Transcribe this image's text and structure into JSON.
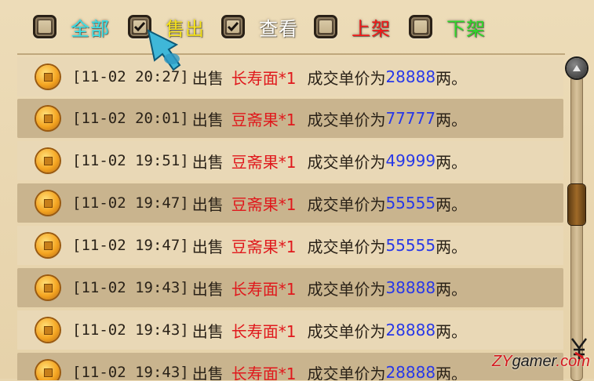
{
  "filters": [
    {
      "label": "全部",
      "checked": false,
      "color": "#38e0e8"
    },
    {
      "label": "售出",
      "checked": true,
      "color": "#f5e21a"
    },
    {
      "label": "查看",
      "checked": true,
      "color": "#ffffff"
    },
    {
      "label": "上架",
      "checked": false,
      "color": "#f01a1a"
    },
    {
      "label": "下架",
      "checked": false,
      "color": "#2fd82a"
    }
  ],
  "records": [
    {
      "time": "[11-02 20:27]",
      "action": "出售",
      "item": "长寿面*1",
      "prefix": "成交单价为",
      "price": "28888",
      "suffix": "两。"
    },
    {
      "time": "[11-02 20:01]",
      "action": "出售",
      "item": "豆斋果*1",
      "prefix": "成交单价为",
      "price": "77777",
      "suffix": "两。"
    },
    {
      "time": "[11-02 19:51]",
      "action": "出售",
      "item": "豆斋果*1",
      "prefix": "成交单价为",
      "price": "49999",
      "suffix": "两。"
    },
    {
      "time": "[11-02 19:47]",
      "action": "出售",
      "item": "豆斋果*1",
      "prefix": "成交单价为",
      "price": "55555",
      "suffix": "两。"
    },
    {
      "time": "[11-02 19:47]",
      "action": "出售",
      "item": "豆斋果*1",
      "prefix": "成交单价为",
      "price": "55555",
      "suffix": "两。"
    },
    {
      "time": "[11-02 19:43]",
      "action": "出售",
      "item": "长寿面*1",
      "prefix": "成交单价为",
      "price": "38888",
      "suffix": "两。"
    },
    {
      "time": "[11-02 19:43]",
      "action": "出售",
      "item": "长寿面*1",
      "prefix": "成交单价为",
      "price": "28888",
      "suffix": "两。"
    },
    {
      "time": "[11-02 19:43]",
      "action": "出售",
      "item": "长寿面*1",
      "prefix": "成交单价为",
      "price": "28888",
      "suffix": "两。"
    }
  ],
  "icons": {
    "record": "coin-icon",
    "scroll_up": "scroll-up-arrow-icon",
    "cursor": "jade-pointer-cursor-icon"
  },
  "watermark": {
    "brand": "ZY",
    "gamer": "gamer",
    "domain": ".com"
  }
}
